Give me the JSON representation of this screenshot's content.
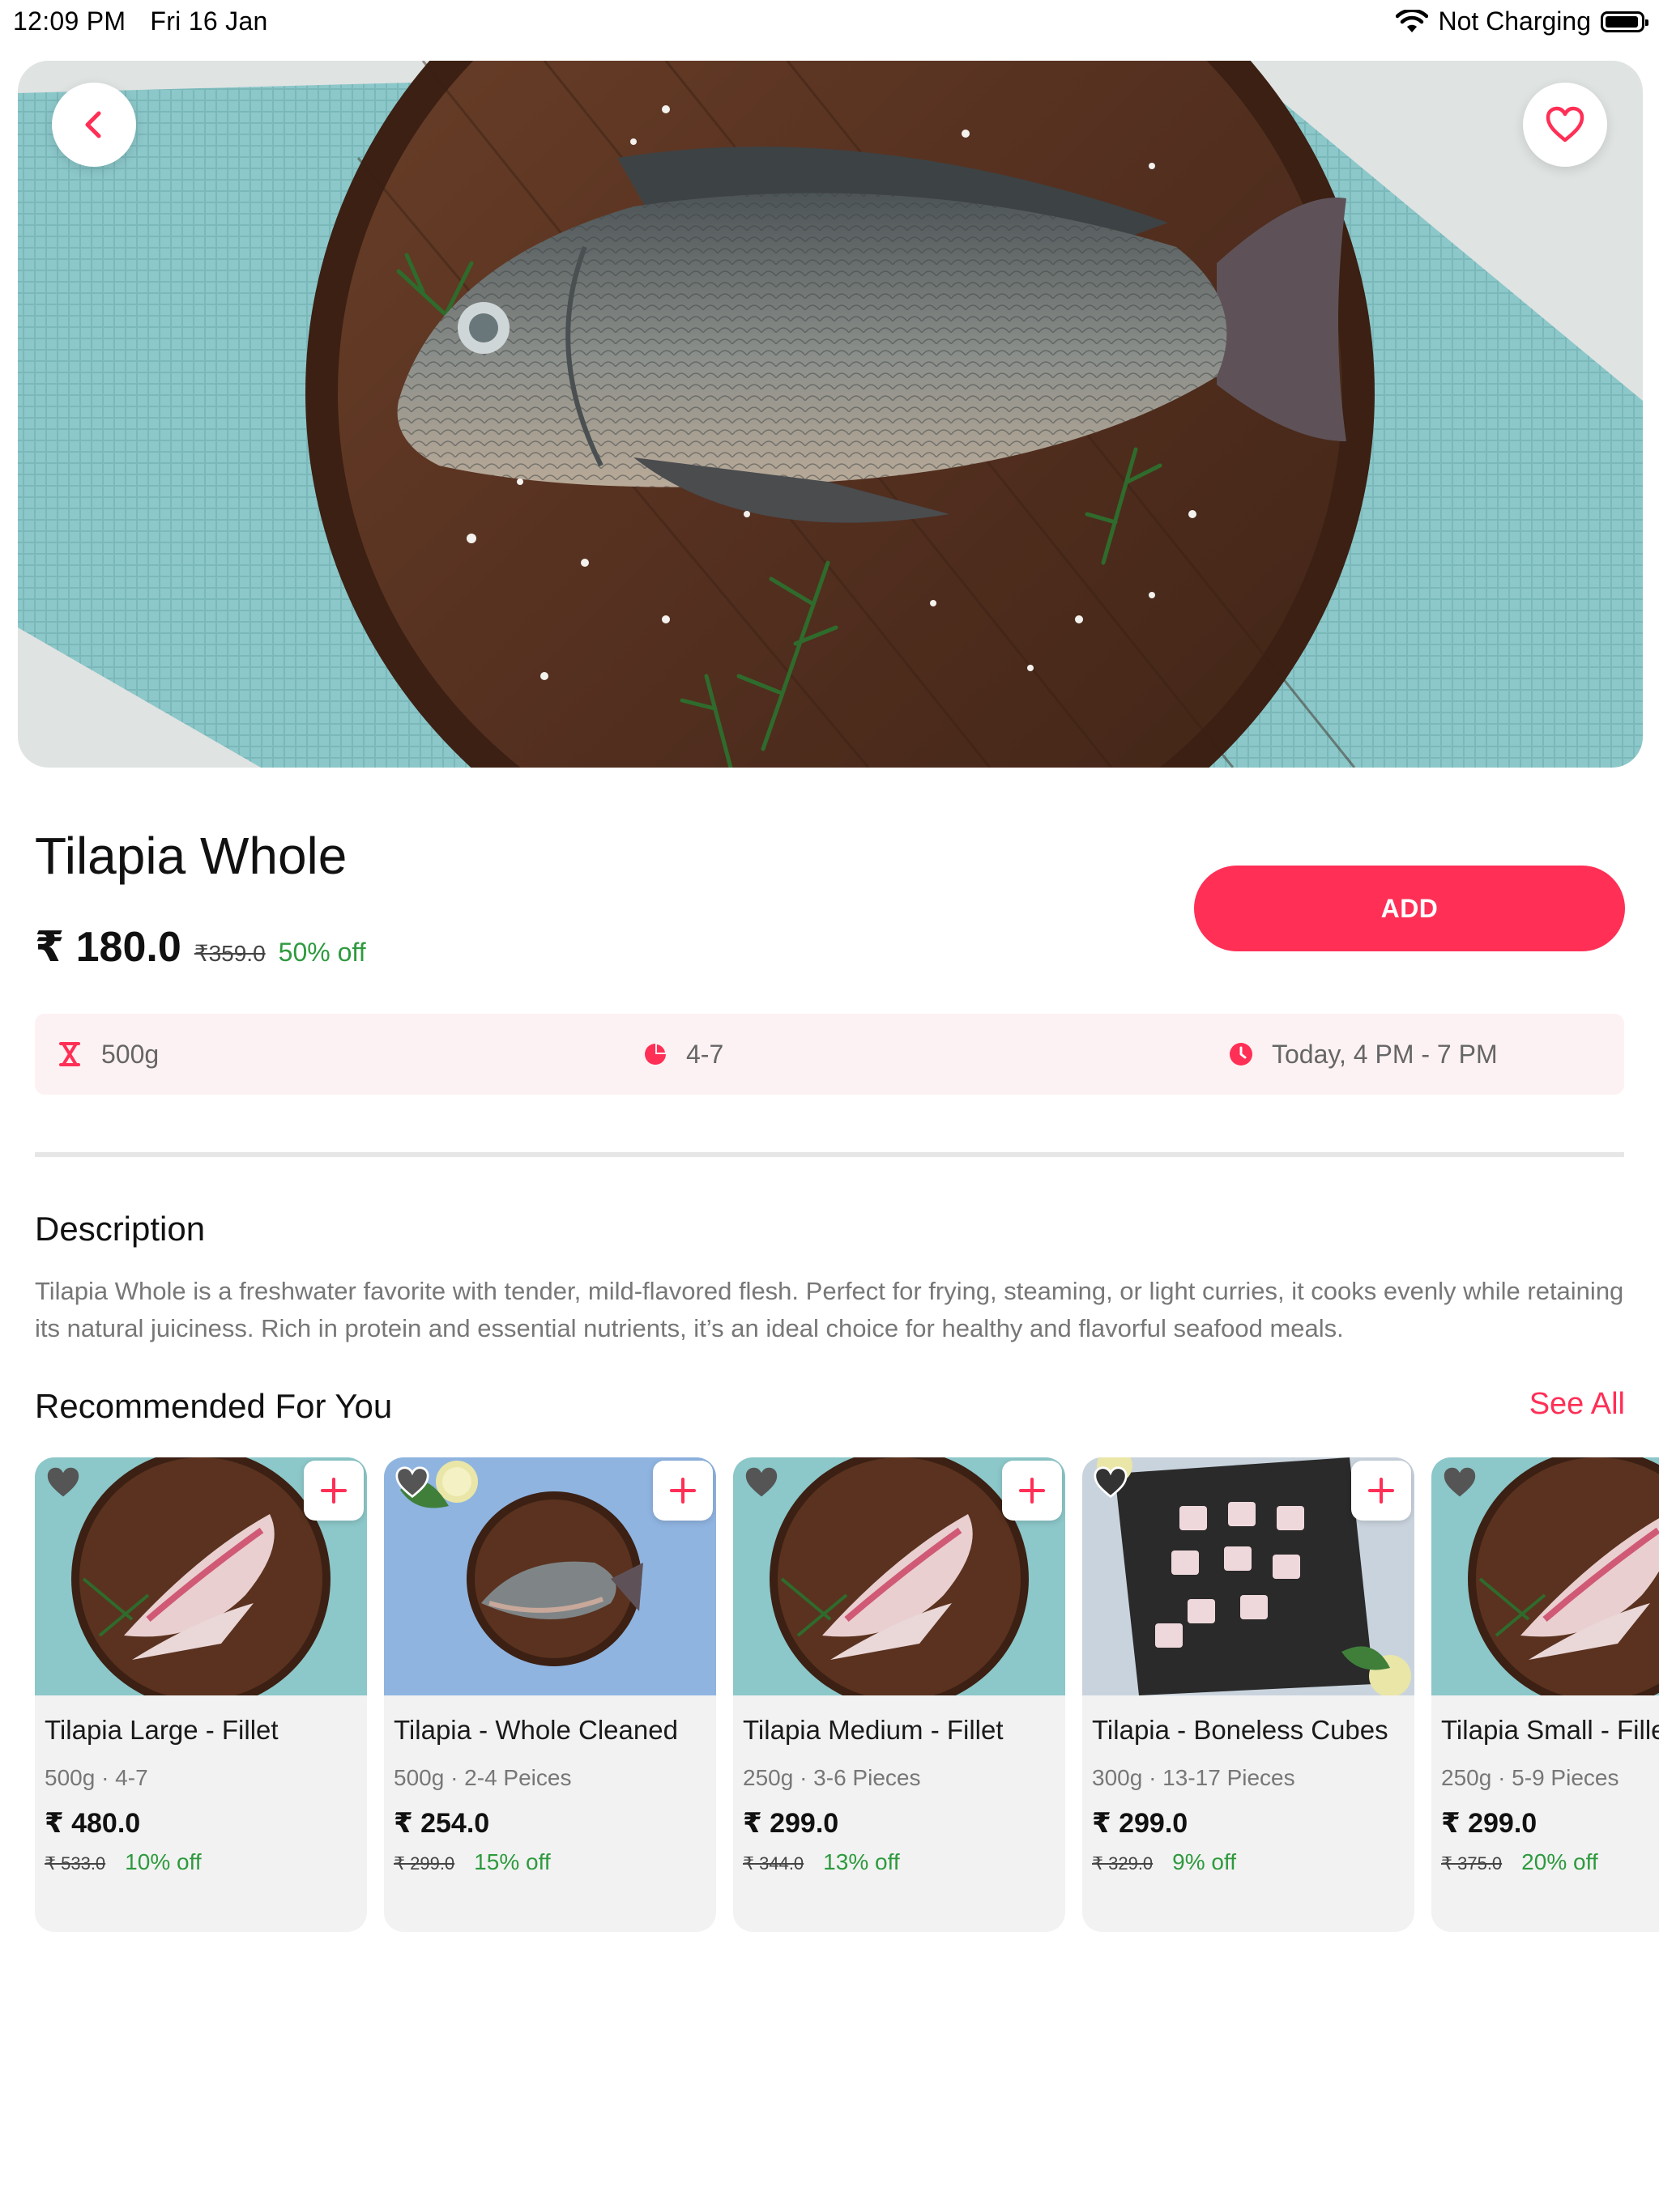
{
  "status_bar": {
    "time": "12:09 PM",
    "date": "Fri 16 Jan",
    "charging": "Not Charging",
    "icons": [
      "wifi-icon",
      "battery-icon"
    ]
  },
  "product": {
    "title": "Tilapia Whole",
    "price": "₹ 180.0",
    "mrp": "₹359.0",
    "discount": "50% off",
    "add_label": "ADD",
    "weight": "500g",
    "pieces": "4-7",
    "delivery": "Today, 4 PM - 7 PM"
  },
  "description": {
    "heading": "Description",
    "text": "Tilapia Whole is a freshwater favorite with tender, mild-flavored flesh. Perfect for frying, steaming, or light curries, it cooks evenly while retaining its natural juiciness. Rich in protein and essential nutrients, it’s an ideal choice for healthy and flavorful seafood meals."
  },
  "recommended": {
    "heading": "Recommended For You",
    "see_all": "See All",
    "items": [
      {
        "name": "Tilapia Large - Fillet",
        "meta": "500g · 4-7",
        "price": "₹ 480.0",
        "mrp": "₹ 533.0",
        "off": "10% off",
        "image": "fillet-on-board"
      },
      {
        "name": "Tilapia  - Whole Cleaned",
        "meta": "500g · 2-4 Peices",
        "price": "₹ 254.0",
        "mrp": "₹ 299.0",
        "off": "15% off",
        "image": "whole-fish-on-blue"
      },
      {
        "name": "Tilapia Medium - Fillet",
        "meta": "250g · 3-6 Pieces",
        "price": "₹ 299.0",
        "mrp": "₹ 344.0",
        "off": "13% off",
        "image": "fillet-on-board"
      },
      {
        "name": "Tilapia - Boneless Cubes",
        "meta": "300g · 13-17 Pieces",
        "price": "₹ 299.0",
        "mrp": "₹ 329.0",
        "off": "9% off",
        "image": "cubes-on-slate"
      },
      {
        "name": "Tilapia Small - Fillet",
        "meta": "250g · 5-9 Pieces",
        "price": "₹ 299.0",
        "mrp": "₹ 375.0",
        "off": "20% off",
        "image": "fillet-on-board"
      }
    ]
  },
  "colors": {
    "accent": "#ff2f56",
    "discount_green": "#2e9a3e",
    "info_bar_bg": "#fdf2f3",
    "card_bg": "#f2f2f2"
  }
}
